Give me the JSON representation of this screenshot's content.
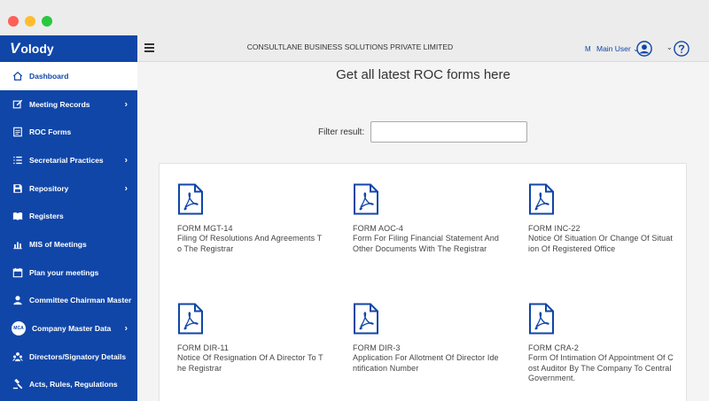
{
  "sidebar": {
    "brand": {
      "first": "V",
      "rest": "olody"
    },
    "items": [
      {
        "label": "Dashboard",
        "icon": "home-icon",
        "active": true,
        "chevron": false
      },
      {
        "label": "Meeting Records",
        "icon": "edit-icon",
        "chevron": true
      },
      {
        "label": "ROC Forms",
        "icon": "document-icon",
        "chevron": false
      },
      {
        "label": "Secretarial Practices",
        "icon": "list-icon",
        "chevron": true
      },
      {
        "label": "Repository",
        "icon": "save-icon",
        "chevron": true
      },
      {
        "label": "Registers",
        "icon": "book-icon",
        "chevron": false
      },
      {
        "label": "MIS of Meetings",
        "icon": "bar-chart-icon",
        "chevron": false
      },
      {
        "label": "Plan your meetings",
        "icon": "calendar-icon",
        "chevron": false
      },
      {
        "label": "Committee Chairman Master",
        "icon": "user-icon",
        "chevron": false
      },
      {
        "label": "Company Master Data",
        "icon": "mca-logo-icon",
        "badge": "MCA",
        "chevron": true
      },
      {
        "label": "Directors/Signatory Details",
        "icon": "people-icon",
        "chevron": false
      },
      {
        "label": "Acts, Rules, Regulations",
        "icon": "gavel-icon",
        "chevron": false
      }
    ]
  },
  "topbar": {
    "company": "CONSULTLANE BUSINESS SOLUTIONS PRIVATE LIMITED",
    "user_initial": "M",
    "user_label": "Main User",
    "user_chevron": "⌄",
    "help_chevron": "⌄"
  },
  "main": {
    "title": "Get all latest ROC forms here",
    "filter_label": "Filter result:",
    "filter_value": "",
    "forms": [
      {
        "name": "FORM MGT-14",
        "description": "Filing Of Resolutions And Agreements To The Registrar"
      },
      {
        "name": "FORM AOC-4",
        "description": "Form For Filing Financial Statement And Other Documents With The Registrar"
      },
      {
        "name": "FORM INC-22",
        "description": "Notice Of Situation Or Change Of Situation Of Registered Office"
      },
      {
        "name": "FORM DIR-11",
        "description": "Notice Of Resignation Of A Director To The Registrar"
      },
      {
        "name": "FORM DIR-3",
        "description": "Application For Allotment Of Director Identification Number"
      },
      {
        "name": "FORM CRA-2",
        "description": "Form Of Intimation Of Appointment Of Cost Auditor By The Company To Central Government."
      }
    ]
  },
  "colors": {
    "brand_blue": "#1046a8",
    "topbar_bg": "#ececec",
    "content_bg": "#f4f4f4"
  }
}
